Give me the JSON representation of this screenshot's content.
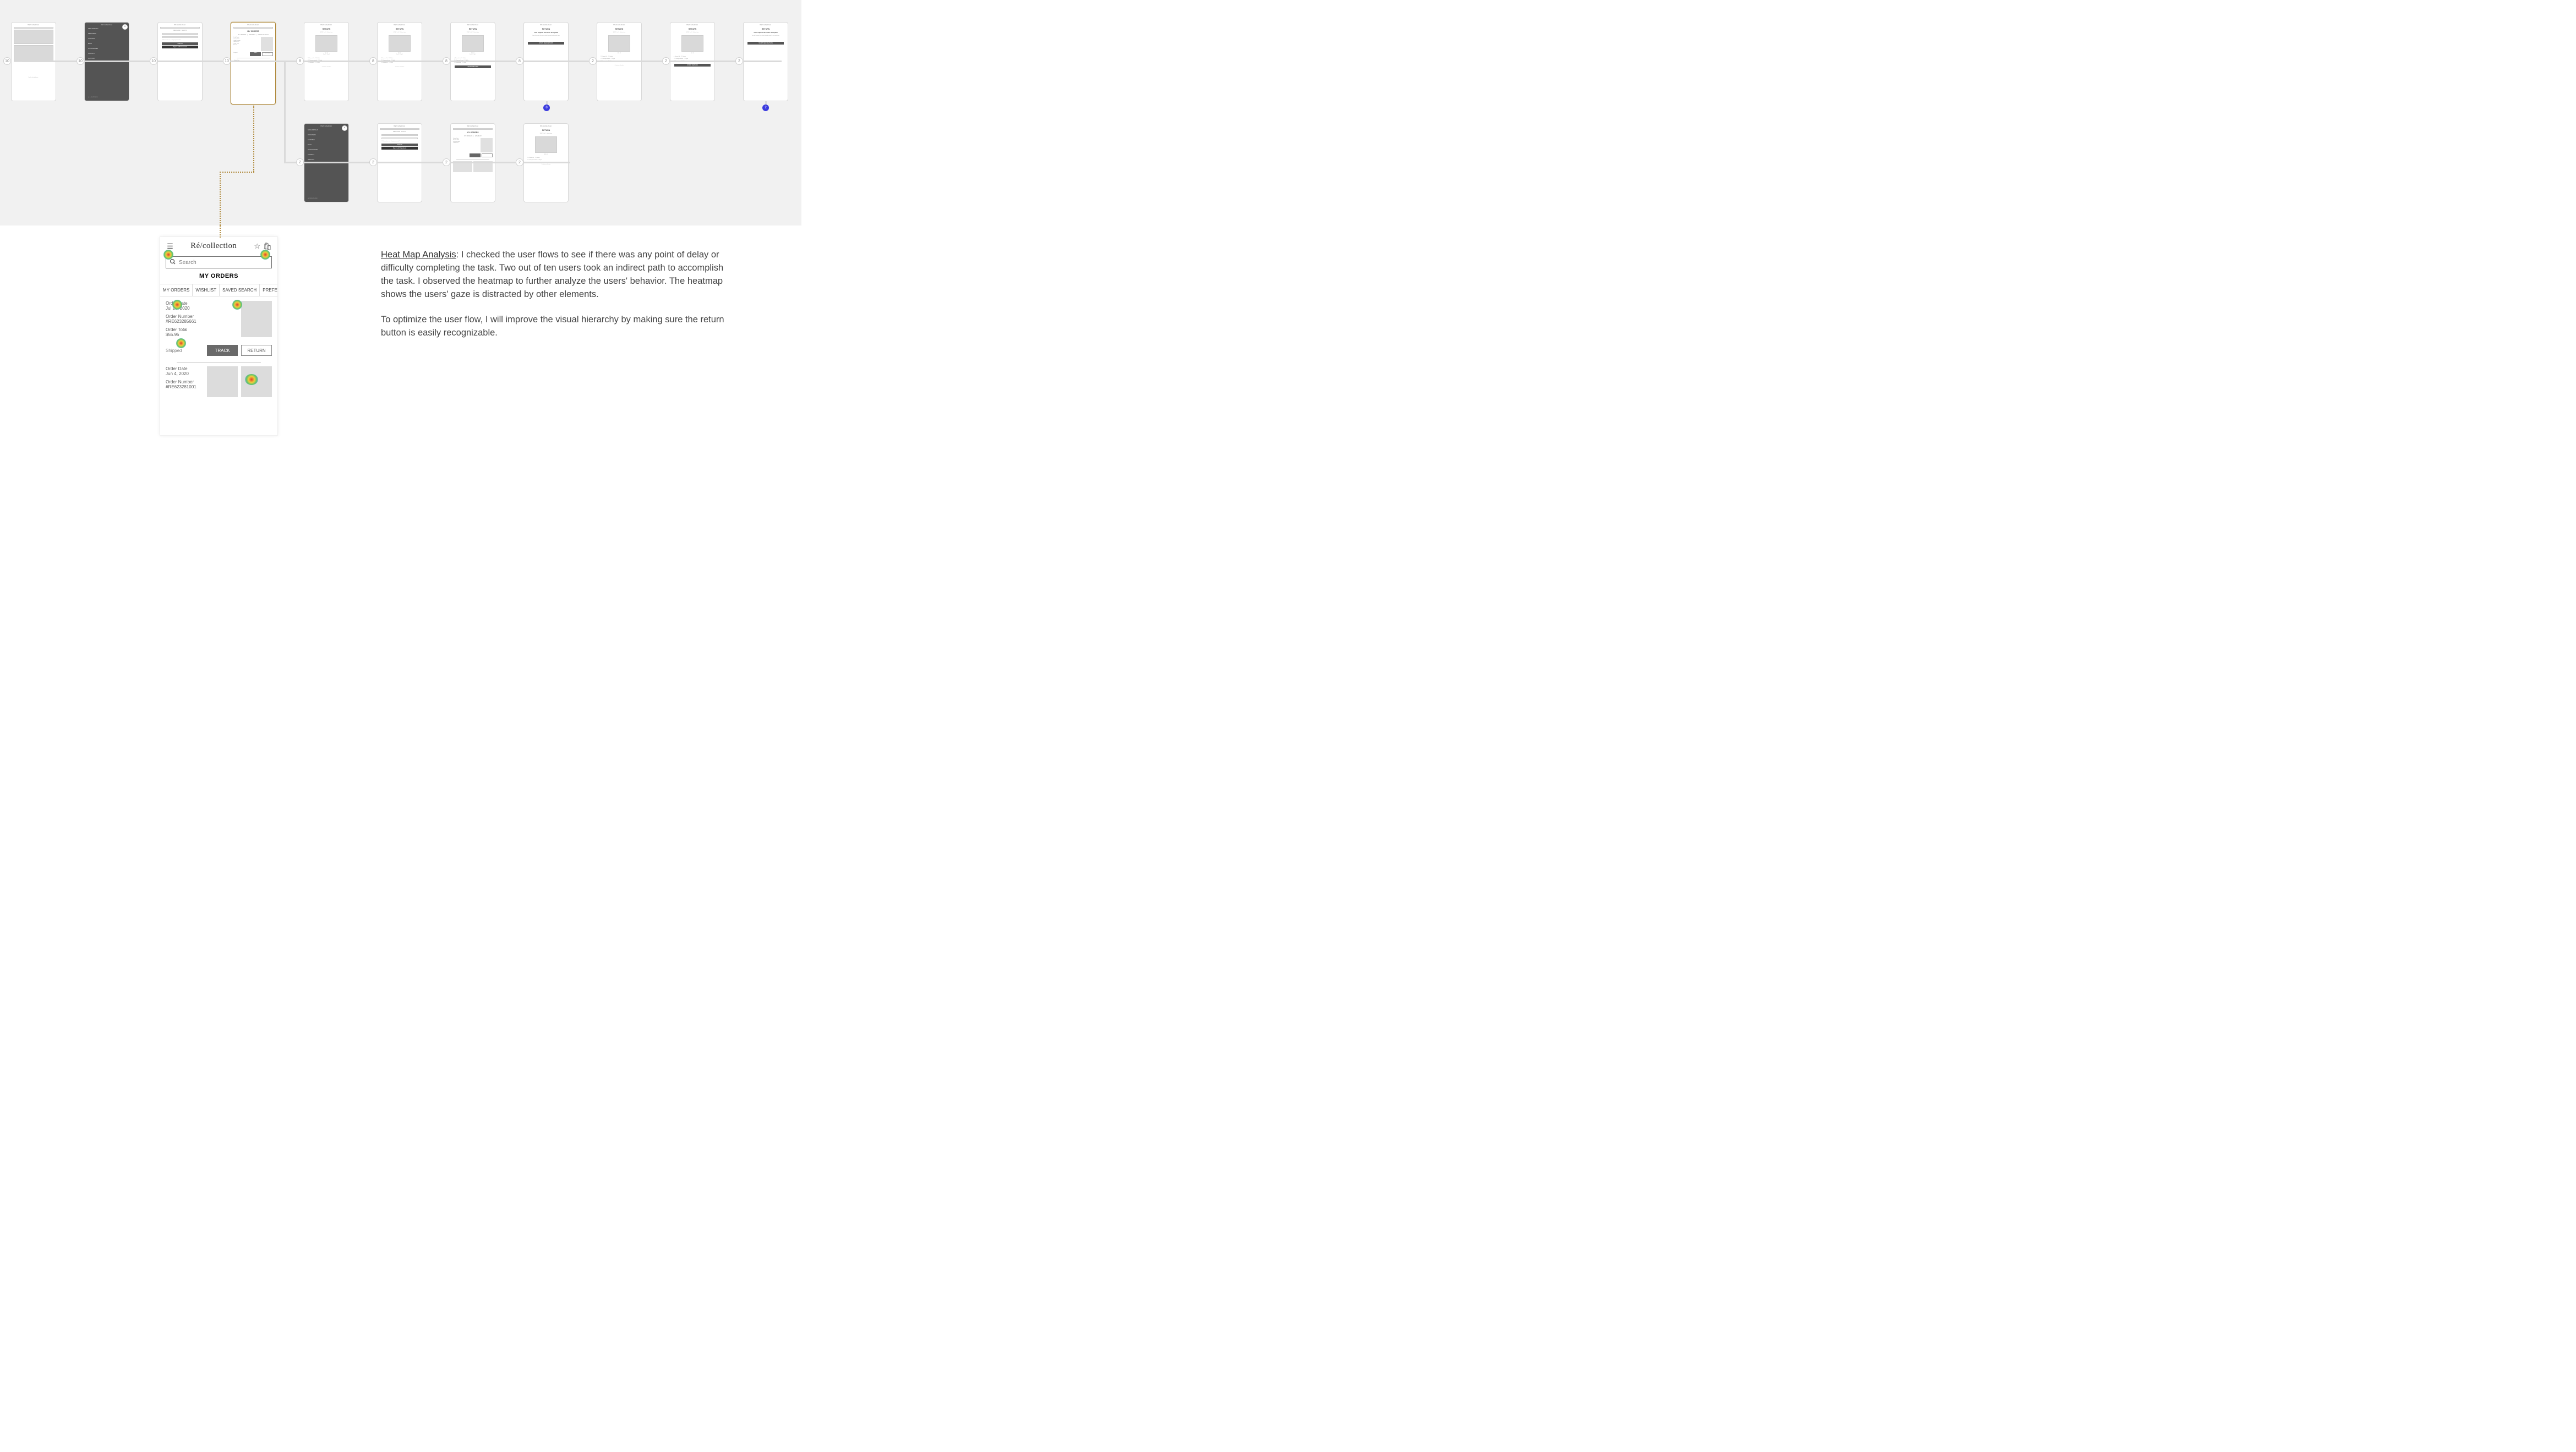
{
  "brand": "Ré/collection",
  "flow": {
    "top_row_counts": [
      10,
      10,
      10,
      10,
      8,
      8,
      8,
      8,
      2,
      2,
      2
    ],
    "bottom_row_counts": [
      2,
      2,
      2,
      2
    ],
    "end_badges": {
      "a": "8",
      "b": "2"
    },
    "menu_items": [
      "NEW ARRIVALS",
      "DESIGNERS",
      "CLOTHING",
      "BAGS",
      "ACCESSORIES",
      "CONTACT",
      "SUPPORT"
    ],
    "menu_footer": "tel: 1-800-555-0100",
    "signin_tabs": [
      "REGISTER",
      "SIGN IN"
    ],
    "signin_button": "SIGN IN",
    "signin_link": "Sign in with Facebook",
    "orders_title": "MY ORDERS",
    "orders_tabs": [
      "MY ORDERS",
      "WISHLIST",
      "SAVED SEARCH",
      "PREFER"
    ],
    "track_btn": "TRACK",
    "return_btn": "RETURN",
    "return_title": "RETURN",
    "step_label": "STEP 1 of 2 · Select item",
    "reasons": [
      "Doesn't fit",
      "Fabric",
      "Changed mind",
      "Style",
      "Damaged",
      "Other"
    ],
    "cta_continue": "Continue selection",
    "cta_start": "START RETURN",
    "cta_new": "START NEW RETURN",
    "accepted_title": "Your request has been accepted!",
    "accepted_body": "You will receive the return label by email in the next hour."
  },
  "detail": {
    "search_placeholder": "Search",
    "section": "MY ORDERS",
    "tabs": [
      "MY ORDERS",
      "WISHLIST",
      "SAVED SEARCH",
      "PREFER"
    ],
    "order1": {
      "date_label": "Order Date",
      "date": "Jul 20, 2020",
      "num_label": "Order Number",
      "num": "#RE623285661",
      "total_label": "Order Total",
      "total": "$55.95",
      "status": "Shipped",
      "track": "TRACK",
      "return": "RETURN"
    },
    "order2": {
      "date_label": "Order Date",
      "date": "Jun 4, 2020",
      "num_label": "Order Number",
      "num": "#RE623281001"
    }
  },
  "analysis": {
    "heading": "Heat Map Analysis",
    "p1": ": I checked the user flows to see if there was any point of delay or difficulty completing the task. Two out of ten users took an indirect path to accomplish the task. I observed the heatmap to further analyze the users' behavior. The heatmap shows the users' gaze is distracted by other elements.",
    "p2": "To optimize the user flow, I will improve the visual hierarchy by making sure the return button is easily recognizable."
  }
}
